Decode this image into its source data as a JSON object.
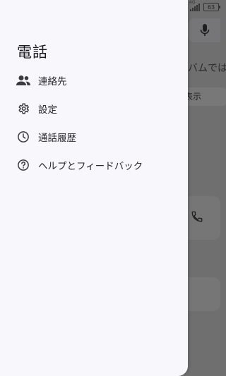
{
  "status_bar": {
    "icons": [
      "vibrate-icon",
      "wifi-icon",
      "hd-icon",
      "signal-icon",
      "battery-icon"
    ],
    "hd_label": "HD",
    "network_label": "4G",
    "battery_level": "63"
  },
  "drawer": {
    "title": "電話",
    "items": [
      {
        "label": "連絡先",
        "icon": "contacts-icon"
      },
      {
        "label": "設定",
        "icon": "settings-icon"
      },
      {
        "label": "通話履歴",
        "icon": "call-history-icon"
      },
      {
        "label": "ヘルプとフィードバック",
        "icon": "help-icon"
      }
    ]
  },
  "background": {
    "partial_text": "バムでは",
    "chip_label": "表示"
  },
  "colors": {
    "drawer_bg": "#f8f8fc",
    "scrim": "#6f6f70",
    "text_primary": "#1b1b1f"
  }
}
